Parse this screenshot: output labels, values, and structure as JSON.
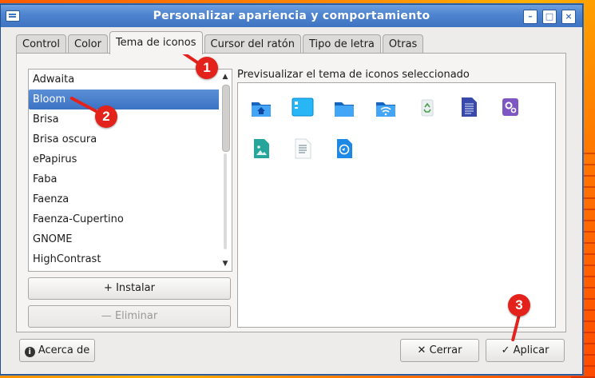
{
  "window": {
    "title": "Personalizar apariencia y comportamiento"
  },
  "tabs": [
    {
      "label": "Control"
    },
    {
      "label": "Color"
    },
    {
      "label": "Tema de iconos"
    },
    {
      "label": "Cursor del ratón"
    },
    {
      "label": "Tipo de letra"
    },
    {
      "label": "Otras"
    }
  ],
  "theme_list": {
    "selected": "Bloom",
    "items": [
      "Adwaita",
      "Bloom",
      "Brisa",
      "Brisa oscura",
      "ePapirus",
      "Faba",
      "Faenza",
      "Faenza-Cupertino",
      "GNOME",
      "HighContrast"
    ]
  },
  "buttons": {
    "install": "Instalar",
    "remove": "Eliminar",
    "about": "Acerca de",
    "close": "Cerrar",
    "apply": "Aplicar"
  },
  "preview": {
    "label": "Previsualizar el tema de iconos seleccionado",
    "icons": [
      "folder-home-icon",
      "computer-icon",
      "folder-icon",
      "network-folder-icon",
      "trash-icon",
      "text-document-icon",
      "settings-app-icon",
      "image-file-icon",
      "text-file-icon",
      "browser-icon"
    ]
  },
  "annotations": {
    "badge1": "1",
    "badge2": "2",
    "badge3": "3"
  },
  "colors": {
    "selection": "#3c72c4",
    "titlebar": "#4d83cf",
    "annotation": "#e3231b",
    "folder_blue": "#1e88e5"
  }
}
